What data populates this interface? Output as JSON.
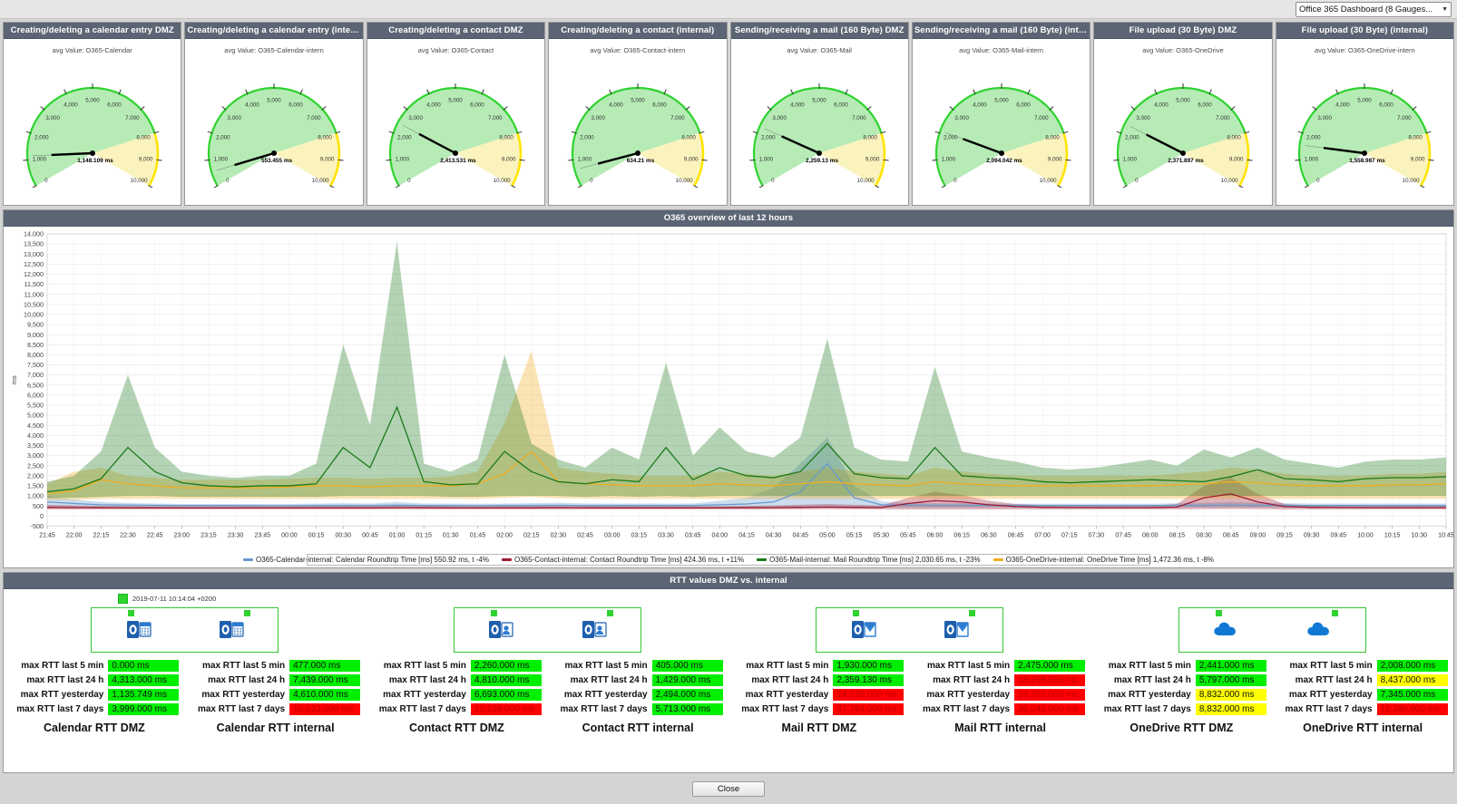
{
  "topbar": {
    "dashboard_select": "Office 365 Dashboard (8 Gauges...",
    "caret": "▼"
  },
  "gauges": [
    {
      "header": "Creating/deleting a calendar entry DMZ",
      "title": "avg Value: O365-Calendar",
      "value_label": "1,148.109 ms",
      "value": 1148.109
    },
    {
      "header": "Creating/deleting a calendar entry (internal)",
      "title": "avg Value: O365-Calendar-intern",
      "value_label": "553.455 ms",
      "value": 553.455
    },
    {
      "header": "Creating/deleting a contact DMZ",
      "title": "avg Value: O365-Contact",
      "value_label": "2,413.531 ms",
      "value": 2413.531
    },
    {
      "header": "Creating/deleting a contact (internal)",
      "title": "avg Value: O365-Contact-intern",
      "value_label": "634.21 ms",
      "value": 634.21
    },
    {
      "header": "Sending/receiving a mail (160 Byte) DMZ",
      "title": "avg Value: O365-Mail",
      "value_label": "2,259.13 ms",
      "value": 2259.13
    },
    {
      "header": "Sending/receiving a mail (160 Byte) (internal)",
      "title": "avg Value: O365-Mail-intern",
      "value_label": "2,094.042 ms",
      "value": 2094.042
    },
    {
      "header": "File upload (30 Byte) DMZ",
      "title": "avg Value: O365-OneDrive",
      "value_label": "2,371.897 ms",
      "value": 2371.897
    },
    {
      "header": "File upload (30 Byte) (internal)",
      "title": "avg Value: O365-OneDrive-intern",
      "value_label": "1,558.987 ms",
      "value": 1558.987
    }
  ],
  "gauge_scale": {
    "min": 0,
    "max": 10000,
    "step": 1000,
    "ticks": [
      "0",
      "1,000",
      "2,000",
      "3,000",
      "4,000",
      "5,000",
      "6,000",
      "7,000",
      "8,000",
      "9,000",
      "10,000"
    ],
    "green_to": 8000,
    "green": "#2fd32f",
    "green_fill": "#b6ebb6",
    "yellow": "#ffe400",
    "yellow_fill": "#fbf3bd"
  },
  "chart": {
    "header": "O365 overview of last 12 hours",
    "ylabel": "ms",
    "legend_entries": [
      {
        "color": "#6699cc",
        "text": "O365-Calendar-internal: Calendar Roundtrip Time [ms] 550.92 ms, t -4%"
      },
      {
        "color": "#9e1b32",
        "text": "O365-Contact-internal: Contact Roundtrip Time [ms] 424.36 ms, t +11%"
      },
      {
        "color": "#1b7a1b",
        "text": "O365-Mail-internal: Mail Roundtrip Time [ms] 2,030.65 ms, t -23%"
      },
      {
        "color": "#f0ad1e",
        "text": "O365-OneDrive-internal: OneDrive Time [ms] 1,472.36 ms, t -8%"
      }
    ]
  },
  "chart_data": {
    "type": "area",
    "title": "O365 overview of last 12 hours",
    "xlabel": "",
    "ylabel": "ms",
    "ylim": [
      -500,
      14000
    ],
    "ytick_step": 500,
    "yticks": [
      "14,000",
      "13,500",
      "13,000",
      "12,500",
      "12,000",
      "11,500",
      "11,000",
      "10,500",
      "10,000",
      "9,500",
      "9,000",
      "8,500",
      "8,000",
      "7,500",
      "7,000",
      "6,500",
      "6,000",
      "5,500",
      "5,000",
      "4,500",
      "4,000",
      "3,500",
      "3,000",
      "2,500",
      "2,000",
      "1,500",
      "1,000",
      "500",
      "0",
      "-500"
    ],
    "grid": true,
    "legend_position": "bottom",
    "x": [
      "21:45",
      "22:00",
      "22:15",
      "22:30",
      "22:45",
      "23:00",
      "23:15",
      "23:30",
      "23:45",
      "00:00",
      "00:15",
      "00:30",
      "00:45",
      "01:00",
      "01:15",
      "01:30",
      "01:45",
      "02:00",
      "02:15",
      "02:30",
      "02:45",
      "03:00",
      "03:15",
      "03:30",
      "03:45",
      "04:00",
      "04:15",
      "04:30",
      "04:45",
      "05:00",
      "05:15",
      "05:30",
      "05:45",
      "06:00",
      "06:15",
      "06:30",
      "06:45",
      "07:00",
      "07:15",
      "07:30",
      "07:45",
      "08:00",
      "08:15",
      "08:30",
      "08:45",
      "09:00",
      "09:15",
      "09:30",
      "09:45",
      "10:00",
      "10:15",
      "10:30",
      "10:45"
    ],
    "series": [
      {
        "name": "O365-Calendar-internal: Calendar Roundtrip Time [ms]",
        "color": "#6699cc",
        "current": 550.92,
        "trend": "-4%",
        "values": [
          700,
          620,
          560,
          540,
          530,
          520,
          520,
          520,
          515,
          515,
          520,
          525,
          520,
          540,
          520,
          520,
          515,
          520,
          525,
          530,
          520,
          520,
          520,
          520,
          520,
          560,
          600,
          700,
          1200,
          2600,
          900,
          560,
          540,
          530,
          530,
          525,
          520,
          520,
          520,
          520,
          520,
          520,
          525,
          530,
          540,
          530,
          525,
          520,
          520,
          520,
          520,
          520,
          520
        ],
        "band_low": [
          420,
          420,
          420,
          420,
          420,
          420,
          420,
          420,
          420,
          420,
          420,
          420,
          420,
          420,
          420,
          420,
          420,
          420,
          420,
          420,
          420,
          420,
          420,
          420,
          420,
          420,
          420,
          420,
          430,
          440,
          430,
          420,
          420,
          420,
          420,
          420,
          420,
          420,
          420,
          420,
          420,
          420,
          420,
          420,
          420,
          420,
          420,
          420,
          420,
          420,
          420,
          420,
          420
        ],
        "band_high": [
          1000,
          820,
          700,
          650,
          620,
          600,
          600,
          600,
          600,
          600,
          620,
          640,
          620,
          700,
          620,
          620,
          610,
          620,
          640,
          660,
          620,
          620,
          620,
          620,
          620,
          760,
          900,
          1400,
          2600,
          3900,
          1500,
          720,
          650,
          630,
          630,
          620,
          610,
          610,
          610,
          610,
          610,
          610,
          640,
          660,
          700,
          660,
          640,
          620,
          620,
          620,
          620,
          620,
          620
        ]
      },
      {
        "name": "O365-Contact-internal: Contact Roundtrip Time [ms]",
        "color": "#9e1b32",
        "current": 424.36,
        "trend": "+11%",
        "values": [
          430,
          420,
          415,
          410,
          408,
          405,
          405,
          405,
          405,
          405,
          408,
          410,
          410,
          420,
          412,
          408,
          405,
          408,
          410,
          412,
          410,
          408,
          408,
          408,
          408,
          410,
          415,
          420,
          430,
          440,
          430,
          420,
          620,
          760,
          700,
          560,
          470,
          430,
          425,
          420,
          420,
          420,
          440,
          900,
          1100,
          700,
          470,
          430,
          425,
          420,
          420,
          420,
          420
        ],
        "band_low": [
          330,
          330,
          330,
          330,
          330,
          330,
          330,
          330,
          330,
          330,
          330,
          330,
          330,
          330,
          330,
          330,
          330,
          330,
          330,
          330,
          330,
          330,
          330,
          330,
          330,
          330,
          330,
          330,
          335,
          340,
          335,
          330,
          330,
          330,
          330,
          330,
          330,
          330,
          330,
          330,
          330,
          330,
          330,
          340,
          350,
          340,
          330,
          330,
          330,
          330,
          330,
          330,
          330
        ],
        "band_high": [
          560,
          520,
          500,
          490,
          480,
          475,
          475,
          475,
          475,
          475,
          480,
          485,
          485,
          510,
          490,
          480,
          475,
          480,
          485,
          490,
          485,
          480,
          480,
          480,
          480,
          485,
          500,
          520,
          560,
          600,
          560,
          520,
          900,
          1200,
          1050,
          760,
          600,
          540,
          520,
          510,
          510,
          510,
          600,
          1500,
          1900,
          1100,
          600,
          520,
          510,
          505,
          505,
          505,
          505
        ]
      },
      {
        "name": "O365-Mail-internal: Mail Roundtrip Time [ms]",
        "color": "#1b7a1b",
        "current": 2030.65,
        "trend": "-23%",
        "values": [
          1200,
          1350,
          1850,
          3400,
          2200,
          1650,
          1500,
          1450,
          1500,
          1500,
          1600,
          3400,
          2400,
          5400,
          1700,
          1550,
          1600,
          3200,
          2200,
          1700,
          1600,
          1800,
          1700,
          3400,
          1800,
          2400,
          2000,
          1900,
          2200,
          3600,
          2100,
          1900,
          1850,
          3400,
          2000,
          1900,
          1850,
          1700,
          1650,
          1700,
          1750,
          1800,
          1750,
          1700,
          1950,
          2300,
          1850,
          1800,
          1700,
          1850,
          1900,
          1900,
          1950
        ],
        "band_low": [
          900,
          900,
          950,
          1000,
          1000,
          950,
          950,
          950,
          950,
          950,
          950,
          1000,
          1000,
          1000,
          1000,
          950,
          950,
          1000,
          1000,
          1000,
          950,
          1000,
          950,
          1000,
          950,
          1000,
          1000,
          1000,
          1000,
          1000,
          1000,
          1000,
          1000,
          1000,
          1000,
          1000,
          1000,
          1000,
          1000,
          1000,
          1000,
          1000,
          1000,
          1000,
          1000,
          1000,
          1000,
          1000,
          1000,
          1000,
          1000,
          1000,
          1000
        ],
        "band_high": [
          1700,
          2000,
          3200,
          7000,
          3400,
          2200,
          2000,
          1900,
          2000,
          2000,
          2600,
          8500,
          4500,
          13600,
          2600,
          2200,
          2800,
          8000,
          3600,
          2800,
          2400,
          3400,
          2800,
          7600,
          3000,
          4400,
          3200,
          2900,
          3900,
          8800,
          3400,
          2800,
          2700,
          7400,
          3200,
          2900,
          2700,
          2400,
          2300,
          2400,
          2600,
          2800,
          2500,
          3300,
          2900,
          3400,
          2800,
          2600,
          2400,
          2700,
          2800,
          2800,
          2900
        ]
      },
      {
        "name": "O365-OneDrive-internal: OneDrive Time [ms]",
        "color": "#f0ad1e",
        "current": 1472.36,
        "trend": "-8%",
        "values": [
          1100,
          1250,
          1800,
          1600,
          1500,
          1400,
          1400,
          1400,
          1400,
          1450,
          1500,
          1500,
          1450,
          1500,
          1500,
          1500,
          1600,
          2100,
          3200,
          1700,
          1600,
          1550,
          1500,
          1500,
          1500,
          1600,
          1550,
          1500,
          1600,
          1700,
          1600,
          1550,
          1500,
          1700,
          1600,
          1550,
          1500,
          1500,
          1500,
          1500,
          1500,
          1500,
          1550,
          1600,
          1700,
          1650,
          1550,
          1500,
          1500,
          1500,
          1550,
          1550,
          1600
        ],
        "band_low": [
          800,
          800,
          850,
          850,
          850,
          850,
          850,
          850,
          850,
          850,
          850,
          850,
          850,
          850,
          850,
          850,
          850,
          900,
          950,
          880,
          860,
          850,
          850,
          850,
          850,
          850,
          850,
          850,
          850,
          850,
          850,
          850,
          850,
          850,
          850,
          850,
          850,
          850,
          850,
          850,
          850,
          850,
          850,
          850,
          850,
          850,
          850,
          850,
          850,
          850,
          850,
          850,
          850
        ],
        "band_high": [
          1600,
          2200,
          2400,
          2000,
          1900,
          1800,
          1800,
          1800,
          1800,
          1850,
          1900,
          1900,
          1850,
          1900,
          1900,
          1950,
          2200,
          4600,
          8200,
          2400,
          2200,
          2100,
          2000,
          2000,
          2000,
          2200,
          2100,
          2000,
          2200,
          2400,
          2200,
          2100,
          2000,
          2400,
          2200,
          2100,
          2000,
          2000,
          2000,
          2000,
          2000,
          2000,
          2100,
          2200,
          2400,
          2300,
          2100,
          2000,
          2000,
          2000,
          2100,
          2100,
          2200
        ]
      }
    ]
  },
  "rtt": {
    "header": "RTT values DMZ vs. internal",
    "timestamp": "2019-07-11 10:14:04 +0200",
    "row_labels": [
      "max RTT last 5 min",
      "max RTT last 24 h",
      "max RTT yesterday",
      "max RTT last 7 days"
    ],
    "columns": [
      {
        "caption": "Calendar RTT DMZ",
        "icon": "outlook-calendar-icon",
        "values": [
          {
            "text": "0.000 ms",
            "state": "green"
          },
          {
            "text": "4,313.000 ms",
            "state": "green"
          },
          {
            "text": "1,135.749 ms",
            "state": "green"
          },
          {
            "text": "3,999.000 ms",
            "state": "green"
          }
        ]
      },
      {
        "caption": "Calendar RTT internal",
        "icon": "outlook-calendar-icon",
        "values": [
          {
            "text": "477.000 ms",
            "state": "green"
          },
          {
            "text": "7,439.000 ms",
            "state": "green"
          },
          {
            "text": "4,610.000 ms",
            "state": "green"
          },
          {
            "text": "10,033.000 ms",
            "state": "red"
          }
        ]
      },
      {
        "caption": "Contact RTT DMZ",
        "icon": "outlook-contact-icon",
        "values": [
          {
            "text": "2,260.000 ms",
            "state": "green"
          },
          {
            "text": "4,810.000 ms",
            "state": "green"
          },
          {
            "text": "6,693.000 ms",
            "state": "green"
          },
          {
            "text": "12,229.000 ms",
            "state": "red"
          }
        ]
      },
      {
        "caption": "Contact RTT internal",
        "icon": "outlook-contact-icon",
        "values": [
          {
            "text": "405.000 ms",
            "state": "green"
          },
          {
            "text": "1,429.000 ms",
            "state": "green"
          },
          {
            "text": "2,494.000 ms",
            "state": "green"
          },
          {
            "text": "5,713.000 ms",
            "state": "green"
          }
        ]
      },
      {
        "caption": "Mail RTT DMZ",
        "icon": "outlook-mail-icon",
        "values": [
          {
            "text": "1,930.000 ms",
            "state": "green"
          },
          {
            "text": "2,359.130 ms",
            "state": "green"
          },
          {
            "text": "24,238.000 ms",
            "state": "red"
          },
          {
            "text": "47,784.000 ms",
            "state": "red"
          }
        ]
      },
      {
        "caption": "Mail RTT internal",
        "icon": "outlook-mail-icon",
        "values": [
          {
            "text": "2,475.000 ms",
            "state": "green"
          },
          {
            "text": "18,269.000 ms",
            "state": "red"
          },
          {
            "text": "18,269.000 ms",
            "state": "red"
          },
          {
            "text": "36,049.000 ms",
            "state": "red"
          }
        ]
      },
      {
        "caption": "OneDrive RTT DMZ",
        "icon": "onedrive-icon",
        "values": [
          {
            "text": "2,441.000 ms",
            "state": "green"
          },
          {
            "text": "5,797.000 ms",
            "state": "green"
          },
          {
            "text": "8,832.000 ms",
            "state": "yellow"
          },
          {
            "text": "8,832.000 ms",
            "state": "yellow"
          }
        ]
      },
      {
        "caption": "OneDrive RTT internal",
        "icon": "onedrive-icon",
        "values": [
          {
            "text": "2,008.000 ms",
            "state": "green"
          },
          {
            "text": "8,437.000 ms",
            "state": "yellow"
          },
          {
            "text": "7,345.000 ms",
            "state": "green"
          },
          {
            "text": "11,380.000 ms",
            "state": "red"
          }
        ]
      }
    ]
  },
  "footer": {
    "close_label": "Close"
  },
  "colors": {
    "green": "#00ee00",
    "yellow": "#ffff00",
    "red": "#ff0000",
    "header": "#5b6574"
  }
}
